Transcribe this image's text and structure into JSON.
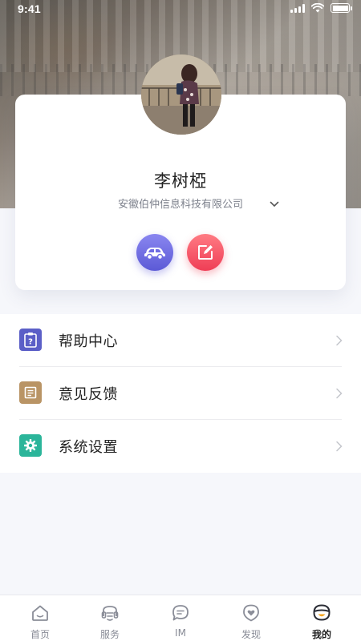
{
  "status_bar": {
    "time": "9:41"
  },
  "profile": {
    "name": "李树椏",
    "company": "安徽伯仲信息科技有限公司"
  },
  "actions": {
    "car_icon": "car-icon",
    "edit_icon": "edit-icon",
    "colors": {
      "car": "#6f6ce3",
      "edit": "#f2485d"
    }
  },
  "menu": {
    "items": [
      {
        "label": "帮助中心",
        "icon": "help-clipboard-icon",
        "color": "#5b5fc7"
      },
      {
        "label": "意见反馈",
        "icon": "feedback-note-icon",
        "color": "#b99465"
      },
      {
        "label": "系统设置",
        "icon": "settings-gear-icon",
        "color": "#2bb59a"
      }
    ]
  },
  "tabbar": {
    "items": [
      {
        "label": "首页",
        "icon": "home-icon",
        "active": false
      },
      {
        "label": "服务",
        "icon": "service-icon",
        "active": false
      },
      {
        "label": "IM",
        "icon": "chat-icon",
        "active": false
      },
      {
        "label": "发现",
        "icon": "discover-heart-icon",
        "active": false
      },
      {
        "label": "我的",
        "icon": "profile-icon",
        "active": true
      }
    ]
  }
}
